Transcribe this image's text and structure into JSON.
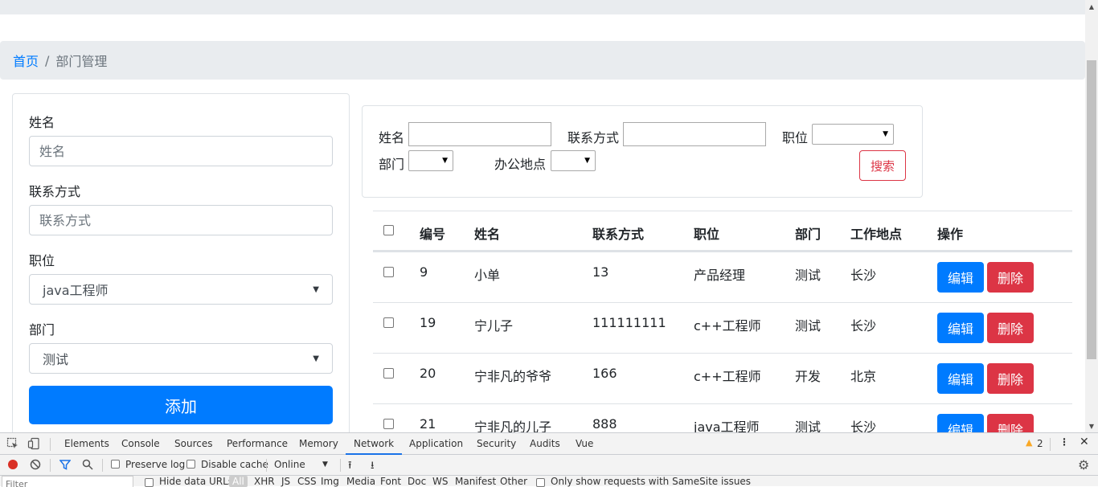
{
  "breadcrumb": {
    "home": "首页",
    "separator": "/",
    "current": "部门管理"
  },
  "form": {
    "name_label": "姓名",
    "name_placeholder": "姓名",
    "contact_label": "联系方式",
    "contact_placeholder": "联系方式",
    "position_label": "职位",
    "position_value": "java工程师",
    "dept_label": "部门",
    "dept_value": "测试",
    "add_button": "添加"
  },
  "search": {
    "name_label": "姓名",
    "contact_label": "联系方式",
    "position_label": "职位",
    "dept_label": "部门",
    "location_label": "办公地点",
    "search_button": "搜索"
  },
  "table": {
    "headers": [
      "编号",
      "姓名",
      "联系方式",
      "职位",
      "部门",
      "工作地点",
      "操作"
    ],
    "edit_label": "编辑",
    "delete_label": "删除",
    "rows": [
      [
        "9",
        "小单",
        "13",
        "产品经理",
        "测试",
        "长沙"
      ],
      [
        "19",
        "宁儿子",
        "111111111",
        "c++工程师",
        "测试",
        "长沙"
      ],
      [
        "20",
        "宁非凡的爷爷",
        "166",
        "c++工程师",
        "开发",
        "北京"
      ],
      [
        "21",
        "宁非凡的儿子",
        "888",
        "java工程师",
        "测试",
        "长沙"
      ]
    ]
  },
  "devtools": {
    "tabs": [
      "Elements",
      "Console",
      "Sources",
      "Performance",
      "Memory",
      "Network",
      "Application",
      "Security",
      "Audits",
      "Vue"
    ],
    "active_tab": "Network",
    "warning_count": "2",
    "preserve_log": "Preserve log",
    "disable_cache": "Disable cache",
    "throttle": "Online",
    "filter_placeholder": "Filter",
    "hide_data_urls": "Hide data URLs",
    "filter_all": "All",
    "filter_types": [
      "XHR",
      "JS",
      "CSS",
      "Img",
      "Media",
      "Font",
      "Doc",
      "WS",
      "Manifest",
      "Other"
    ],
    "samesite": "Only show requests with SameSite issues"
  },
  "colors": {
    "primary": "#007bff",
    "danger": "#dc3545",
    "breadcrumb_bg": "#e9ecef"
  }
}
